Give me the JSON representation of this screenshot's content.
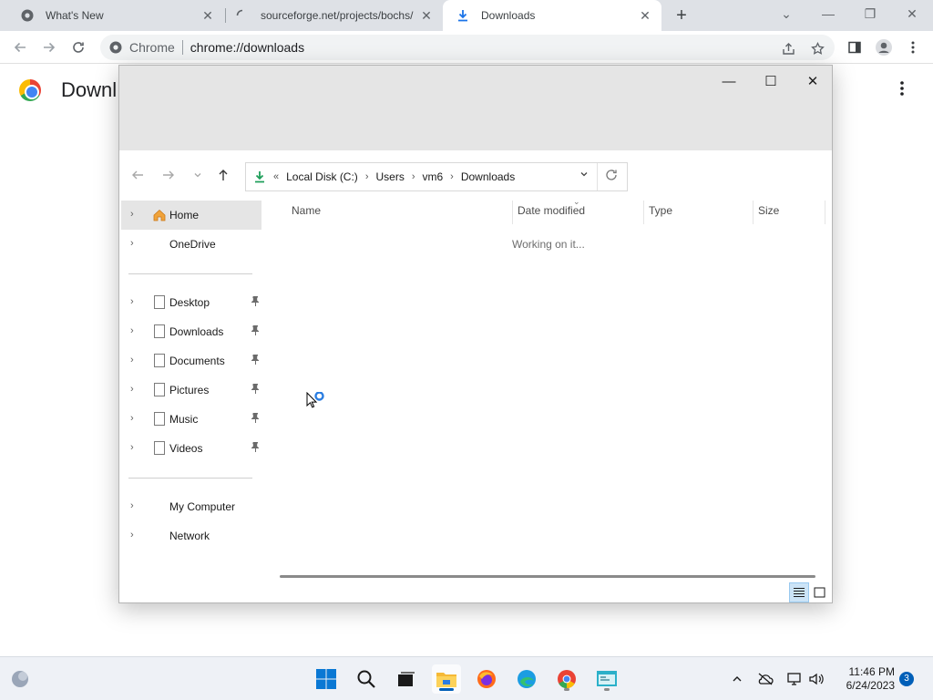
{
  "browser": {
    "tabs": [
      {
        "title": "What's New",
        "close": "✕"
      },
      {
        "title": "sourceforge.net/projects/bochs/",
        "close": "✕"
      },
      {
        "title": "Downloads",
        "close": "✕"
      }
    ],
    "new_tab": "+",
    "window_controls": {
      "minimize": "—",
      "maximize": "❐",
      "close": "✕",
      "tab_search": "⌄"
    },
    "omnibox": {
      "site_label": "Chrome",
      "url": "chrome://downloads"
    }
  },
  "downloads_page": {
    "title": "Downl"
  },
  "file_dialog": {
    "controls": {
      "minimize": "—",
      "maximize": "☐",
      "close": "✕"
    },
    "breadcrumb": {
      "overflow": "«",
      "parts": [
        "Local Disk (C:)",
        "Users",
        "vm6",
        "Downloads"
      ]
    },
    "nav": {
      "top": [
        {
          "label": "Home",
          "selected": true,
          "icon": "home-icon"
        },
        {
          "label": "OneDrive",
          "selected": false,
          "icon": "none"
        }
      ],
      "quick_access": [
        {
          "label": "Desktop",
          "icon": "page-icon"
        },
        {
          "label": "Downloads",
          "icon": "page-icon"
        },
        {
          "label": "Documents",
          "icon": "page-icon"
        },
        {
          "label": "Pictures",
          "icon": "page-icon"
        },
        {
          "label": "Music",
          "icon": "page-icon"
        },
        {
          "label": "Videos",
          "icon": "page-icon"
        }
      ],
      "bottom": [
        {
          "label": "My Computer"
        },
        {
          "label": "Network"
        }
      ]
    },
    "columns": [
      "Name",
      "Date modified",
      "Type",
      "Size"
    ],
    "status_text": "Working on it..."
  },
  "taskbar": {
    "clock_time": "11:46 PM",
    "clock_date": "6/24/2023",
    "notification_count": "3",
    "colors": {
      "accent": "#005fb8",
      "chrome_active_tab": "#ffffff",
      "tabstrip": "#dee1e6"
    }
  }
}
